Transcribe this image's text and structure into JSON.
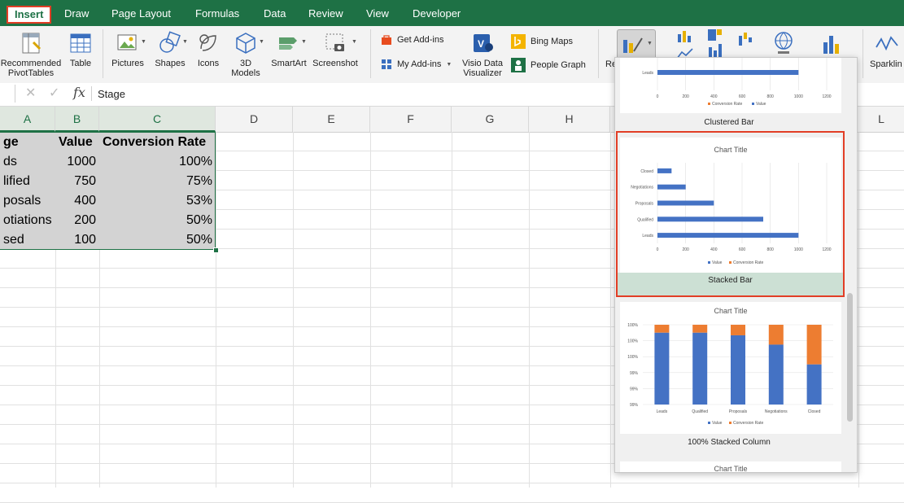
{
  "ribbon_tabs": [
    "Insert",
    "Draw",
    "Page Layout",
    "Formulas",
    "Data",
    "Review",
    "View",
    "Developer"
  ],
  "ribbon": {
    "recommended_pivot": "Recommended\nPivotTables",
    "table": "Table",
    "pictures": "Pictures",
    "shapes": "Shapes",
    "icons": "Icons",
    "models": "3D\nModels",
    "smartart": "SmartArt",
    "screenshot": "Screenshot",
    "get_addins": "Get Add-ins",
    "my_addins": "My Add-ins",
    "visio": "Visio Data\nVisualizer",
    "bing_maps": "Bing Maps",
    "people_graph": "People Graph",
    "recommended_charts_partial": "Re",
    "sparklines_partial": "Sparklin"
  },
  "formula_bar": {
    "fx": "fx",
    "value": "Stage"
  },
  "columns": [
    "A",
    "B",
    "C",
    "D",
    "E",
    "F",
    "G",
    "H",
    "L"
  ],
  "table": {
    "headers": [
      "ge",
      "Value",
      "Conversion Rate"
    ],
    "rows": [
      [
        "ds",
        "1000",
        "100%"
      ],
      [
        "lified",
        "750",
        "75%"
      ],
      [
        "posals",
        "400",
        "53%"
      ],
      [
        "otiations",
        "200",
        "50%"
      ],
      [
        "sed",
        "100",
        "50%"
      ]
    ]
  },
  "gallery": {
    "items": [
      {
        "label": "Clustered Bar"
      },
      {
        "label": "Stacked Bar"
      },
      {
        "label": "100% Stacked Column"
      }
    ],
    "partial_title": "Chart Title"
  },
  "chart_previews": [
    {
      "type": "bar",
      "title": "",
      "categories": [
        "Leads"
      ],
      "series": [
        {
          "name": "Value",
          "values": [
            1000
          ]
        }
      ],
      "xticks": [
        "0",
        "200",
        "400",
        "600",
        "800",
        "1000",
        "1200"
      ],
      "legend": [
        "Conversion Rate",
        "Value"
      ]
    },
    {
      "type": "bar",
      "title": "Chart Title",
      "categories": [
        "Closed",
        "Negotiations",
        "Proposals",
        "Qualified",
        "Leads"
      ],
      "series": [
        {
          "name": "Value",
          "values": [
            100,
            200,
            400,
            750,
            1000
          ]
        }
      ],
      "xticks": [
        "0",
        "200",
        "400",
        "600",
        "800",
        "1000",
        "1200"
      ],
      "legend": [
        "Value",
        "Conversion Rate"
      ]
    },
    {
      "type": "bar",
      "title": "Chart Title",
      "categories": [
        "Leads",
        "Qualified",
        "Proposals",
        "Negotiations",
        "Closed"
      ],
      "series": [
        {
          "name": "Value",
          "values": [
            1000,
            750,
            400,
            200,
            100
          ]
        },
        {
          "name": "Conversion Rate",
          "values": [
            1,
            0.75,
            0.53,
            0.5,
            0.5
          ]
        }
      ],
      "yticks": [
        "100%",
        "100%",
        "100%",
        "99%",
        "99%",
        "99%"
      ],
      "legend": [
        "Value",
        "Conversion Rate"
      ]
    }
  ],
  "colors": {
    "green": "#1e7145",
    "blue": "#4472c4",
    "orange": "#ed7d31",
    "highlight": "#e23e26"
  }
}
